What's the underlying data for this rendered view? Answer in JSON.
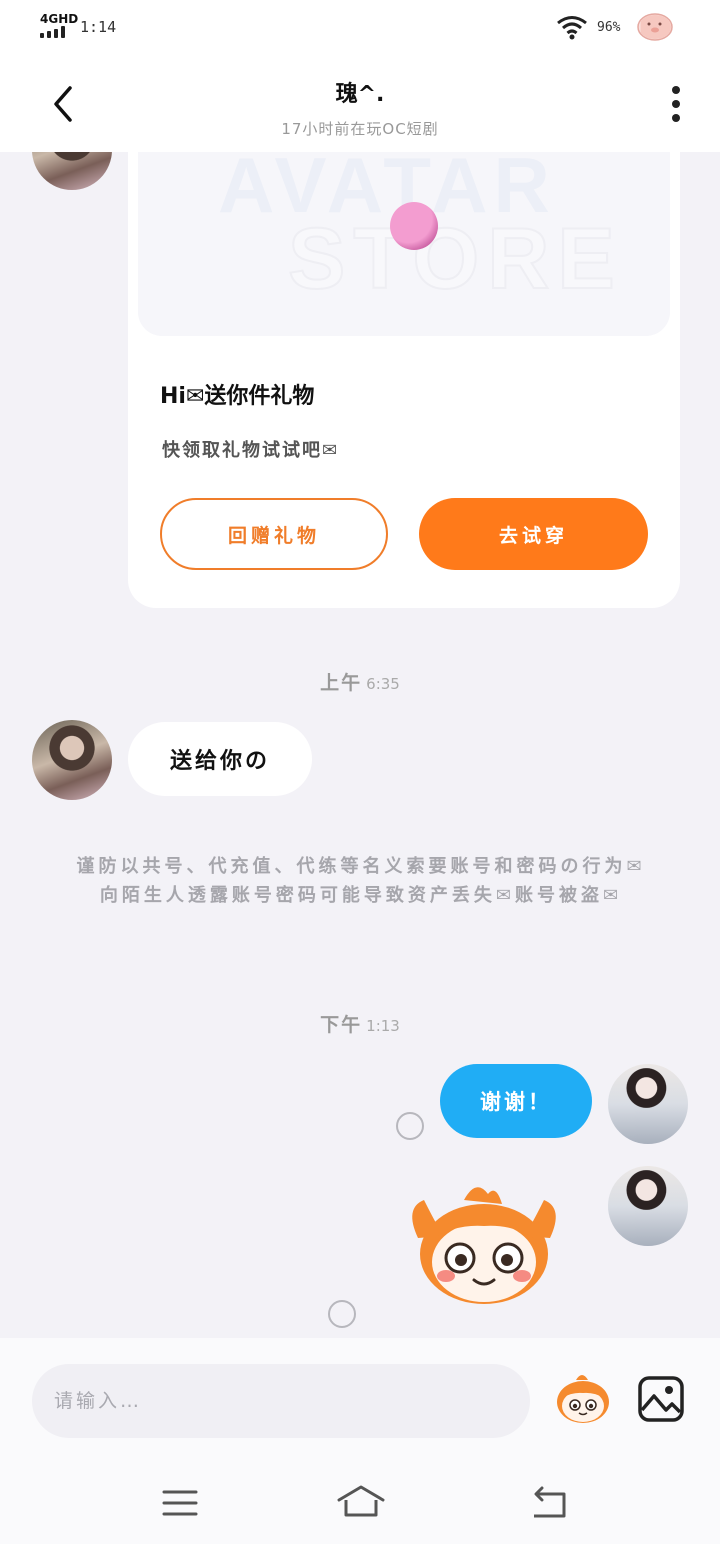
{
  "status_bar": {
    "network": "4GHD",
    "time": "1:14",
    "battery": "96%"
  },
  "header": {
    "title": "瑰^.",
    "subtitle": "17小时前在玩OC短剧"
  },
  "gift_card": {
    "image_text_1": "AVATAR",
    "image_text_2": "STORE",
    "line1": "Hi✉送你件礼物",
    "line2": "快领取礼物试试吧✉",
    "return_button": "回赠礼物",
    "try_button": "去试穿"
  },
  "messages": {
    "time1_prefix": "上午",
    "time1": "6:35",
    "incoming_text": "送给你の",
    "warning": "谨防以共号、代充值、代练等名义索要账号和密码の行为✉向陌生人透露账号密码可能导致资产丢失✉账号被盗✉",
    "time2_prefix": "下午",
    "time2": "1:13",
    "outgoing_text": "谢谢！"
  },
  "input": {
    "placeholder": "请输入…"
  },
  "icons": {
    "back": "chevron-left-icon",
    "more": "more-vertical-icon",
    "emoji": "emoji-sticker-icon",
    "image": "image-icon",
    "nav_menu": "menu-icon",
    "nav_home": "home-icon",
    "nav_back": "back-icon"
  },
  "colors": {
    "accent_orange": "#ff7a1a",
    "bubble_blue": "#20adf5",
    "background": "#f3f2f7"
  }
}
